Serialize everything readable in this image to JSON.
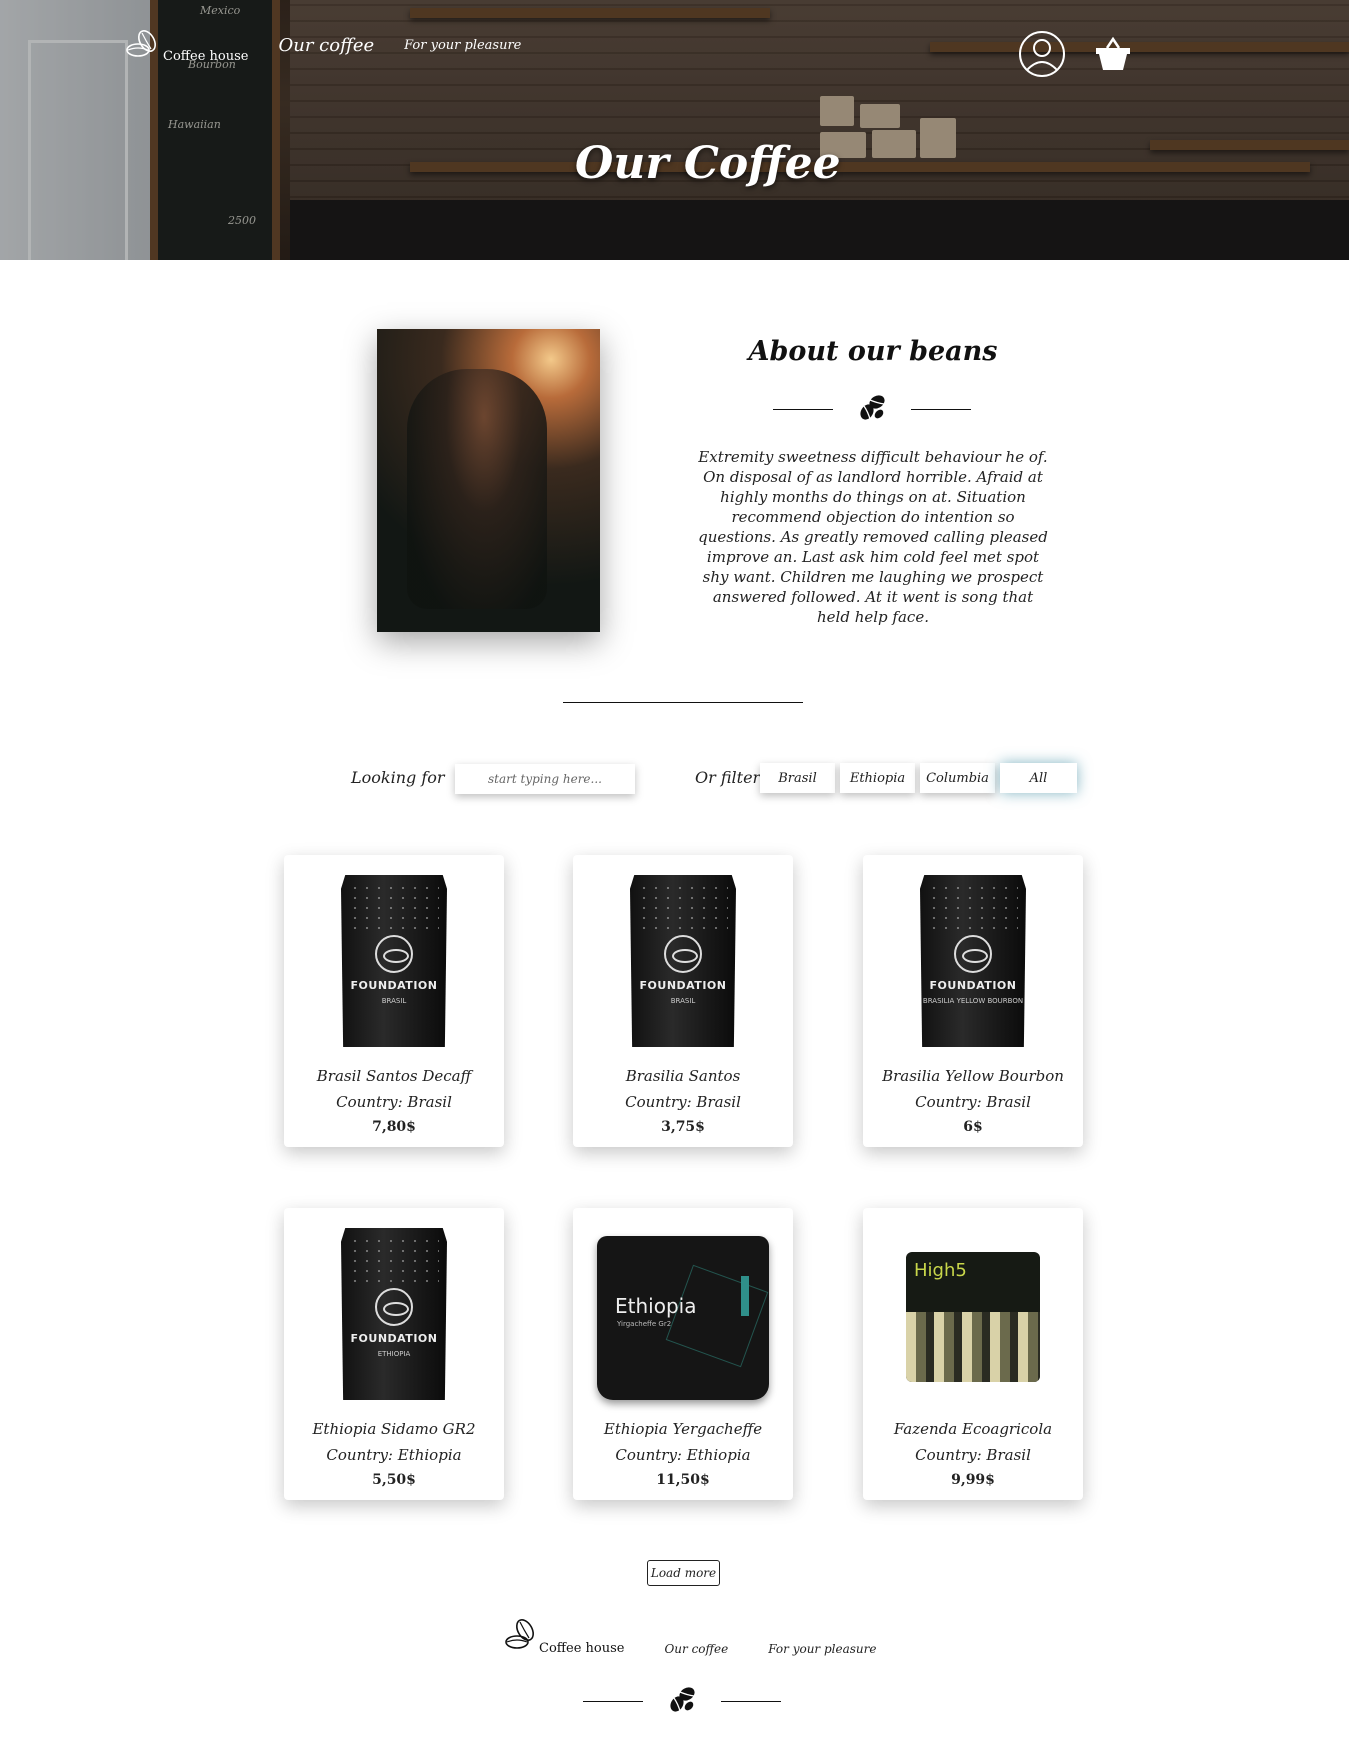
{
  "header": {
    "brand_label": "Coffee house",
    "nav": [
      "Our coffee",
      "For your pleasure"
    ],
    "hero_title": "Our Coffee"
  },
  "about": {
    "title": "About our beans",
    "text": "Extremity sweetness difficult behaviour he of. On disposal of as landlord horrible. Afraid at highly months do things on at. Situation recommend objection do intention so questions. As greatly removed calling pleased improve an. Last ask him cold feel met spot shy want. Children me laughing we prospect answered followed. At it went is song that held help face."
  },
  "filter": {
    "search_label": "Looking for",
    "search_placeholder": "start typing here...",
    "filter_label": "Or filter",
    "options": [
      "Brasil",
      "Ethiopia",
      "Columbia",
      "All"
    ],
    "active": "All"
  },
  "products": [
    {
      "name": "Brasil Santos Decaff",
      "country": "Country: Brasil",
      "price": "7,80$",
      "bag_title": "FOUNDATION",
      "bag_sub": "BRASIL"
    },
    {
      "name": "Brasilia Santos",
      "country": "Country: Brasil",
      "price": "3,75$",
      "bag_title": "FOUNDATION",
      "bag_sub": "BRASIL"
    },
    {
      "name": "Brasilia Yellow Bourbon",
      "country": "Country: Brasil",
      "price": "6$",
      "bag_title": "FOUNDATION",
      "bag_sub": "BRASILIA YELLOW BOURBON"
    },
    {
      "name": "Ethiopia Sidamo GR2",
      "country": "Country: Ethiopia",
      "price": "5,50$",
      "bag_title": "FOUNDATION",
      "bag_sub": "ETHIOPIA"
    },
    {
      "name": "Ethiopia Yergacheffe",
      "country": "Country: Ethiopia",
      "price": "11,50$",
      "bag_title": "Ethiopia",
      "bag_sub": "Yirgacheffe Gr2"
    },
    {
      "name": "Fazenda Ecoagricola",
      "country": "Country: Brasil",
      "price": "9,99$",
      "bag_title": "High5"
    }
  ],
  "load_more": "Load more",
  "footer": {
    "brand_label": "Coffee house",
    "nav": [
      "Our coffee",
      "For your pleasure"
    ]
  },
  "icons": [
    "coffee-beans-logo-icon",
    "user-icon",
    "cart-icon",
    "coffee-beans-divider-icon"
  ],
  "colors": {
    "active_glow": "#5096aa",
    "text": "#222222",
    "background": "#ffffff"
  }
}
